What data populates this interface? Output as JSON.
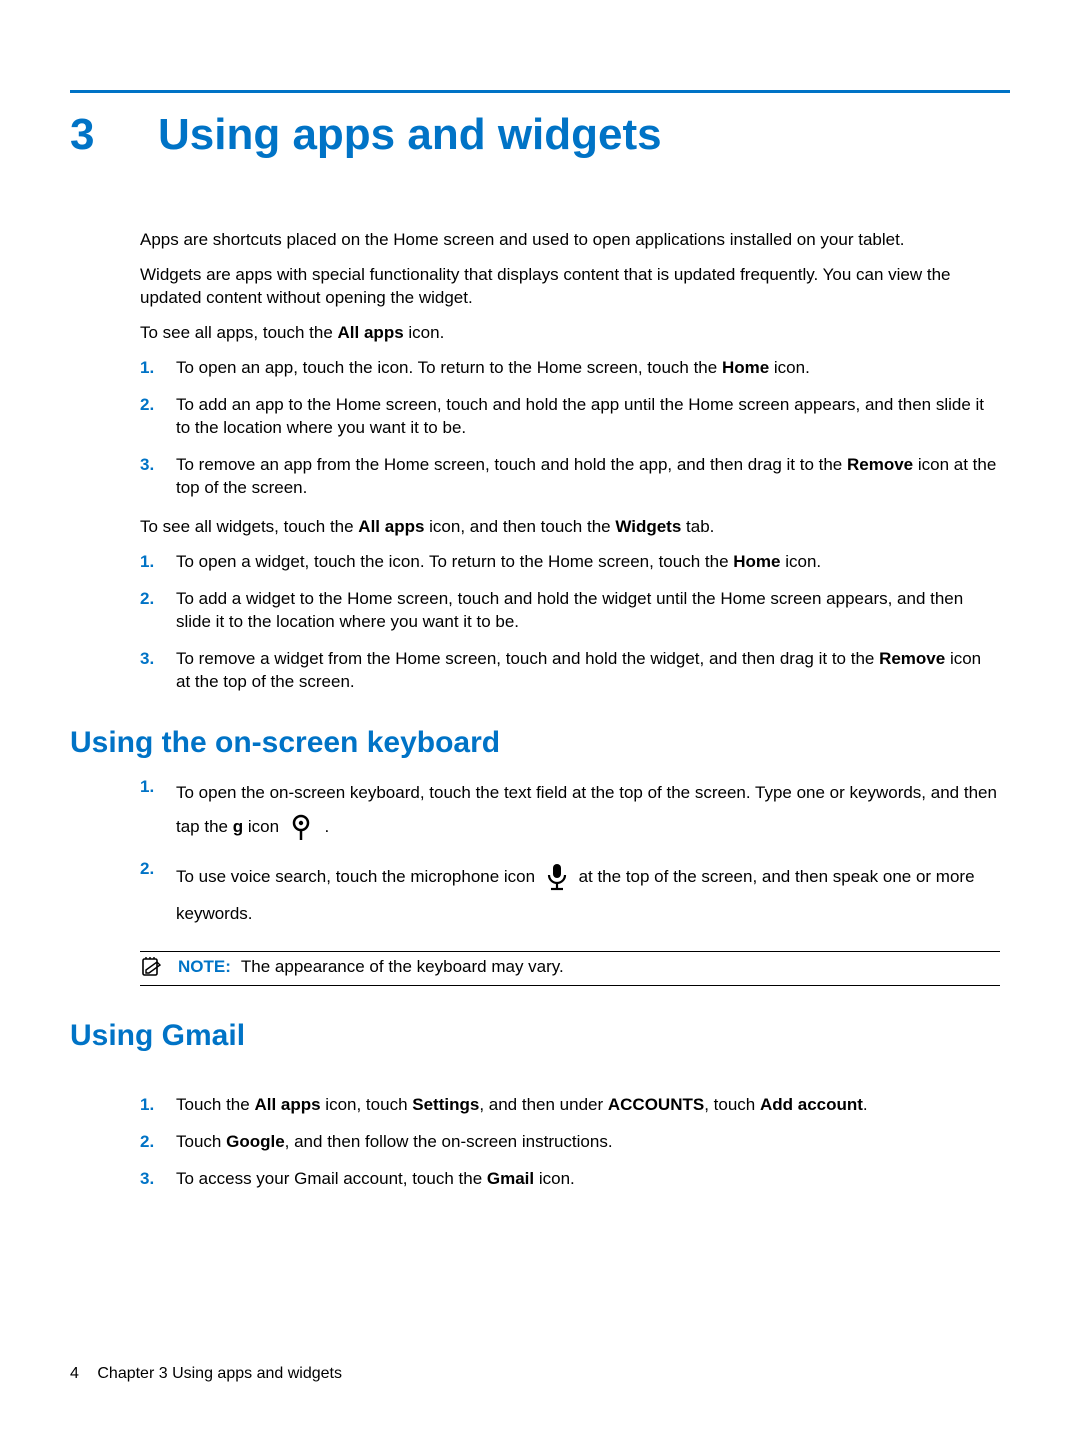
{
  "chapter": {
    "number": "3",
    "title": "Using apps and widgets"
  },
  "intro": {
    "p1": "Apps are shortcuts placed on the Home screen and used to open applications installed on your tablet.",
    "p2": "Widgets are apps with special functionality that displays content that is updated frequently. You can view the updated content without opening the widget.",
    "p3_a": "To see all apps, touch the ",
    "p3_b": "All apps",
    "p3_c": " icon.",
    "list1": {
      "i1_a": "To open an app, touch the icon. To return to the Home screen, touch the ",
      "i1_b": "Home",
      "i1_c": " icon.",
      "i2": "To add an app to the Home screen, touch and hold the app until the Home screen appears, and then slide it to the location where you want it to be.",
      "i3_a": "To remove an app from the Home screen, touch and hold the app, and then drag it to the ",
      "i3_b": "Remove",
      "i3_c": " icon at the top of the screen."
    },
    "p4_a": "To see all widgets, touch the ",
    "p4_b": "All apps",
    "p4_c": " icon, and then touch the ",
    "p4_d": "Widgets",
    "p4_e": " tab.",
    "list2": {
      "i1_a": "To open a widget, touch the icon. To return to the Home screen, touch the ",
      "i1_b": "Home",
      "i1_c": " icon.",
      "i2": "To add a widget to the Home screen, touch and hold the widget until the Home screen appears, and then slide it to the location where you want it to be.",
      "i3_a": "To remove a widget from the Home screen, touch and hold the widget, and then drag it to the ",
      "i3_b": "Remove",
      "i3_c": " icon at the top of the screen."
    }
  },
  "keyboard": {
    "heading": "Using the on-screen keyboard",
    "i1_a": "To open the on-screen keyboard, touch the text field at the top of the screen. Type one or keywords, and then tap the ",
    "i1_b": "g",
    "i1_c": " icon ",
    "i1_d": " .",
    "i2_a": "To use voice search, touch the microphone icon ",
    "i2_b": " at the top of the screen, and then speak one or more keywords.",
    "note_label": "NOTE:",
    "note_text": "The appearance of the keyboard may vary."
  },
  "gmail": {
    "heading": "Using Gmail",
    "i1_a": "Touch the ",
    "i1_b": "All apps",
    "i1_c": " icon, touch ",
    "i1_d": "Settings",
    "i1_e": ", and then under ",
    "i1_f": "ACCOUNTS",
    "i1_g": ", touch ",
    "i1_h": "Add account",
    "i1_i": ".",
    "i2_a": "Touch ",
    "i2_b": "Google",
    "i2_c": ", and then follow the on-screen instructions.",
    "i3_a": "To access your Gmail account, touch the ",
    "i3_b": "Gmail",
    "i3_c": " icon."
  },
  "footer": {
    "page": "4",
    "chapter_label": "Chapter 3   Using apps and widgets"
  },
  "markers": {
    "n1": "1.",
    "n2": "2.",
    "n3": "3."
  }
}
